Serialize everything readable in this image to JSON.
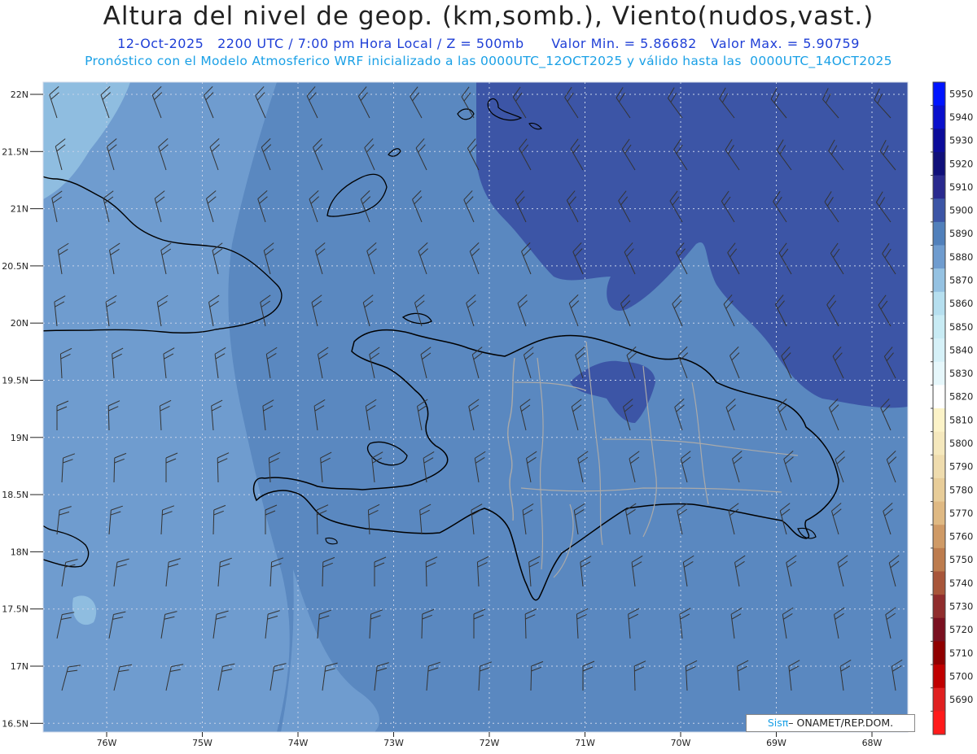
{
  "header": {
    "title": "Altura del nivel de geop. (km,somb.), Viento(nudos,vast.)",
    "line2": "12-Oct-2025   2200 UTC / 7:00 pm Hora Local / Z = 500mb      Valor Min. = 5.86682   Valor Max. = 5.90759",
    "line3": "Pronóstico con el Modelo Atmosferico WRF inicializado a las 0000UTC_12OCT2025 y válido hasta las  0000UTC_14OCT2025"
  },
  "axes": {
    "lat_labels": [
      "22N",
      "21.5N",
      "21N",
      "20.5N",
      "20N",
      "19.5N",
      "19N",
      "18.5N",
      "18N",
      "17.5N",
      "17N",
      "16.5N"
    ],
    "lon_labels": [
      "76W",
      "75W",
      "74W",
      "73W",
      "72W",
      "71W",
      "70W",
      "69W",
      "68W"
    ]
  },
  "colorbar": {
    "levels": [
      5950,
      5940,
      5930,
      5920,
      5910,
      5900,
      5890,
      5880,
      5870,
      5860,
      5850,
      5840,
      5830,
      5820,
      5810,
      5800,
      5790,
      5780,
      5770,
      5760,
      5750,
      5740,
      5730,
      5720,
      5710,
      5700,
      5690
    ],
    "colors": [
      "#0014ff",
      "#0a10cc",
      "#0c0c9a",
      "#10107a",
      "#2a2a8e",
      "#3c55a6",
      "#5180bb",
      "#6f9ccf",
      "#95c2e2",
      "#b6dfef",
      "#c8ebf4",
      "#d6f1f8",
      "#e6f7fb",
      "#ffffff",
      "#fcf3c8",
      "#f5e8bd",
      "#efdcae",
      "#e8cd99",
      "#dfb983",
      "#cf9a66",
      "#bd7c4e",
      "#a8563a",
      "#902d2d",
      "#7a1020",
      "#900000",
      "#c00000",
      "#e02020",
      "#ff1a1a"
    ]
  },
  "credit": {
    "brand": "Sis",
    "brand_pi": "π",
    "rest": "– ONAMET/REP.DOM."
  }
}
